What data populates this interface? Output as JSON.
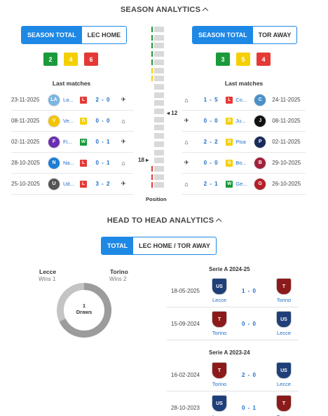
{
  "season": {
    "title": "SEASON ANALYTICS",
    "left": {
      "tabs": [
        "SEASON TOTAL",
        "LEC HOME"
      ],
      "wins": "2",
      "draws": "4",
      "losses": "6",
      "last_matches_title": "Last matches",
      "matches": [
        {
          "date": "23-11-2025",
          "team": "La...",
          "logo": "LA",
          "logo_color": "#7ab6e0",
          "result": "L",
          "score": "2 - 0",
          "venue_icon": "plane-icon",
          "venue": "✈"
        },
        {
          "date": "08-11-2025",
          "team": "Ve...",
          "logo": "V",
          "logo_color": "#f3c400",
          "result": "D",
          "score": "0 - 0",
          "venue_icon": "home-icon",
          "venue": "⌂"
        },
        {
          "date": "02-11-2025",
          "team": "Fi...",
          "logo": "F",
          "logo_color": "#6a2fb0",
          "result": "W",
          "score": "0 - 1",
          "venue_icon": "plane-icon",
          "venue": "✈"
        },
        {
          "date": "28-10-2025",
          "team": "Na...",
          "logo": "N",
          "logo_color": "#1b7fd6",
          "result": "L",
          "score": "0 - 1",
          "venue_icon": "home-icon",
          "venue": "⌂"
        },
        {
          "date": "25-10-2025",
          "team": "Ud...",
          "logo": "U",
          "logo_color": "#555555",
          "result": "L",
          "score": "3 - 2",
          "venue_icon": "plane-icon",
          "venue": "✈"
        }
      ]
    },
    "right": {
      "tabs": [
        "SEASON TOTAL",
        "TOR AWAY"
      ],
      "wins": "3",
      "draws": "5",
      "losses": "4",
      "last_matches_title": "Last matches",
      "matches": [
        {
          "date": "24-11-2025",
          "team": "Co...",
          "logo": "C",
          "logo_color": "#4a90c8",
          "result": "L",
          "score": "1 - 5",
          "venue_icon": "home-icon",
          "venue": "⌂"
        },
        {
          "date": "08-11-2025",
          "team": "Ju...",
          "logo": "J",
          "logo_color": "#111111",
          "result": "D",
          "score": "0 - 0",
          "venue_icon": "plane-icon",
          "venue": "✈"
        },
        {
          "date": "02-11-2025",
          "team": "Pisa",
          "logo": "P",
          "logo_color": "#1a2a5a",
          "result": "D",
          "score": "2 - 2",
          "venue_icon": "home-icon",
          "venue": "⌂"
        },
        {
          "date": "29-10-2025",
          "team": "Bo...",
          "logo": "B",
          "logo_color": "#a3203b",
          "result": "D",
          "score": "0 - 0",
          "venue_icon": "plane-icon",
          "venue": "✈"
        },
        {
          "date": "26-10-2025",
          "team": "Ge...",
          "logo": "G",
          "logo_color": "#b3202a",
          "result": "W",
          "score": "2 - 1",
          "venue_icon": "home-icon",
          "venue": "⌂"
        }
      ]
    },
    "position": {
      "label": "Position",
      "right_marker": "12",
      "left_marker": "18"
    }
  },
  "h2h": {
    "title": "HEAD TO HEAD ANALYTICS",
    "tabs": [
      "TOTAL",
      "LEC HOME / TOR AWAY"
    ],
    "home_team": "Lecce",
    "home_wins": "Wins 1",
    "away_team": "Torino",
    "away_wins": "Wins 2",
    "draws_value": "1",
    "draws_label": "Draws",
    "competitions": [
      {
        "name": "Serie A 2024-25",
        "matches": [
          {
            "date": "18-05-2025",
            "home": "Lecce",
            "away": "Torino",
            "score": "1 - 0"
          },
          {
            "date": "15-09-2024",
            "home": "Torino",
            "away": "Lecce",
            "score": "0 - 0"
          }
        ]
      },
      {
        "name": "Serie A 2023-24",
        "matches": [
          {
            "date": "16-02-2024",
            "home": "Torino",
            "away": "Lecce",
            "score": "2 - 0"
          },
          {
            "date": "28-10-2023",
            "home": "Lecce",
            "away": "Torino",
            "score": "0 - 1"
          }
        ]
      }
    ]
  },
  "colors": {
    "accent": "#1e88e5",
    "win": "#1a9a3a",
    "draw": "#f5d000",
    "loss": "#e53935",
    "lecce": "#1f3f7a",
    "torino": "#8b1a1a"
  }
}
